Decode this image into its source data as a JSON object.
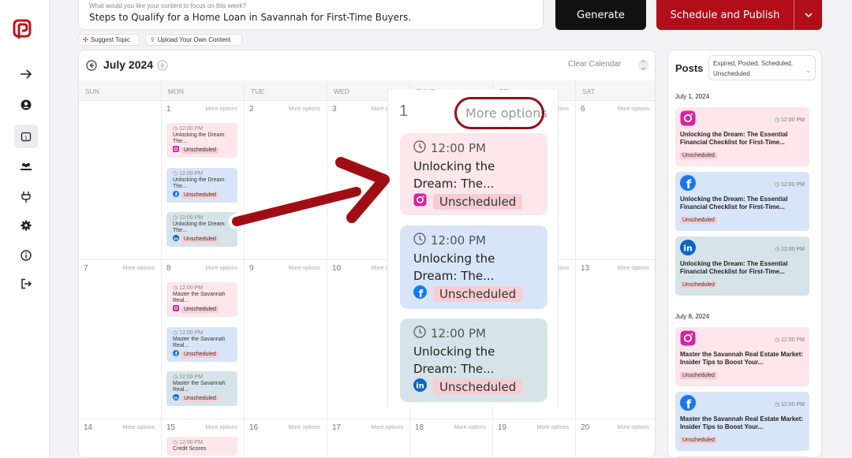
{
  "prompt": {
    "label": "What would you like your content to focus on this week?",
    "value": "Steps to Qualify for a Home Loan in Savannah for First-Time Buyers."
  },
  "actions": {
    "generate": "Generate",
    "schedule_publish": "Schedule and Publish"
  },
  "chips": {
    "suggest": "Suggest Topic",
    "upload": "Upload Your Own Content"
  },
  "calendar": {
    "month": "July 2024",
    "clear": "Clear Calendar",
    "weekdays": [
      "SUN",
      "MON",
      "TUE",
      "WED",
      "THUR",
      "FRI",
      "SAT"
    ],
    "more": "More options",
    "days": {
      "d1": "1",
      "d2": "2",
      "d3": "3",
      "d6": "6",
      "d7": "7",
      "d8": "8",
      "d9": "9",
      "d10": "10",
      "d13": "13",
      "d14": "14",
      "d15": "15",
      "d16": "16",
      "d17": "17",
      "d18": "18",
      "d19": "19",
      "d20": "20"
    },
    "posts": {
      "time": "12:00 PM",
      "unlocking": "Unlocking the Dream: The...",
      "master": "Master the Savannah Real...",
      "credit": "Credit Scores",
      "status": "Unscheduled"
    }
  },
  "zoom": {
    "day": "1",
    "more": "More options",
    "time": "12:00 PM",
    "title_line1": "Unlocking the",
    "title_line2": "Dream: The...",
    "status": "Unscheduled"
  },
  "sidebar_posts": {
    "title": "Posts",
    "filter": "Expired, Posted, Scheduled, Unscheduled",
    "date1": "July 1, 2024",
    "date2": "July 8, 2024",
    "time": "12:00 PM",
    "unlocking_title": "Unlocking the Dream: The Essential Financial Checklist for First-Time...",
    "master_title": "Master the Savannah Real Estate Market: Insider Tips to Boost Your...",
    "status": "Unscheduled"
  },
  "colors": {
    "brand": "#b10e1a",
    "pink": "#fde7ec",
    "blue": "#d8e5f8",
    "teal": "#d6e4ea",
    "badge": "#f6cdd2"
  },
  "icons": [
    "logo-icon",
    "arrow-right-icon",
    "user-circle-icon",
    "calendar-icon",
    "team-icon",
    "plug-icon",
    "gear-icon",
    "info-icon",
    "logout-icon",
    "instagram-icon",
    "facebook-icon",
    "linkedin-icon",
    "clock-icon"
  ]
}
